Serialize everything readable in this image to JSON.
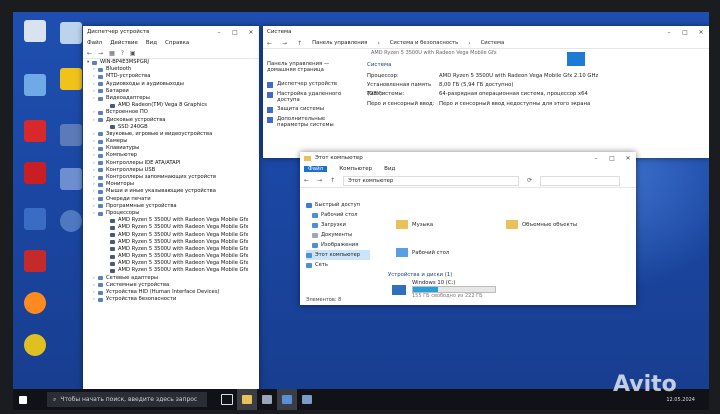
{
  "device_manager": {
    "title": "Диспетчер устройств",
    "menu": [
      "Файл",
      "Действие",
      "Вид",
      "Справка"
    ],
    "root": "WIN-BP4E3MSPGRJ",
    "items": [
      {
        "label": "Bluetooth",
        "level": 1
      },
      {
        "label": "MTD-устройства",
        "level": 1
      },
      {
        "label": "Аудиовходы и аудиовыходы",
        "level": 1
      },
      {
        "label": "Батареи",
        "level": 1
      },
      {
        "label": "Видеоадаптеры",
        "level": 1
      },
      {
        "label": "AMD Radeon(TM) Vega 8 Graphics",
        "level": 2
      },
      {
        "label": "Встроенное ПО",
        "level": 1
      },
      {
        "label": "Дисковые устройства",
        "level": 1
      },
      {
        "label": "SSD 240GB",
        "level": 2
      },
      {
        "label": "Звуковые, игровые и видеоустройства",
        "level": 1
      },
      {
        "label": "Камеры",
        "level": 1
      },
      {
        "label": "Клавиатуры",
        "level": 1
      },
      {
        "label": "Компьютер",
        "level": 1
      },
      {
        "label": "Контроллеры IDE ATA/ATAPI",
        "level": 1
      },
      {
        "label": "Контроллеры USB",
        "level": 1
      },
      {
        "label": "Контроллеры запоминающих устройств",
        "level": 1
      },
      {
        "label": "Мониторы",
        "level": 1
      },
      {
        "label": "Мыши и иные указывающие устройства",
        "level": 1
      },
      {
        "label": "Очереди печати",
        "level": 1
      },
      {
        "label": "Программные устройства",
        "level": 1
      },
      {
        "label": "Процессоры",
        "level": 1
      },
      {
        "label": "AMD Ryzen 5 3500U with Radeon Vega Mobile Gfx",
        "level": 2
      },
      {
        "label": "AMD Ryzen 5 3500U with Radeon Vega Mobile Gfx",
        "level": 2
      },
      {
        "label": "AMD Ryzen 5 3500U with Radeon Vega Mobile Gfx",
        "level": 2
      },
      {
        "label": "AMD Ryzen 5 3500U with Radeon Vega Mobile Gfx",
        "level": 2
      },
      {
        "label": "AMD Ryzen 5 3500U with Radeon Vega Mobile Gfx",
        "level": 2
      },
      {
        "label": "AMD Ryzen 5 3500U with Radeon Vega Mobile Gfx",
        "level": 2
      },
      {
        "label": "AMD Ryzen 5 3500U with Radeon Vega Mobile Gfx",
        "level": 2
      },
      {
        "label": "AMD Ryzen 5 3500U with Radeon Vega Mobile Gfx",
        "level": 2
      },
      {
        "label": "Сетевые адаптеры",
        "level": 1
      },
      {
        "label": "Системные устройства",
        "level": 1
      },
      {
        "label": "Устройства HID (Human Interface Devices)",
        "level": 1
      },
      {
        "label": "Устройства безопасности",
        "level": 1
      }
    ]
  },
  "system": {
    "title": "Система",
    "breadcrumb": [
      "Панель управления",
      "Система и безопасность",
      "Система"
    ],
    "side": [
      {
        "label": "Панель управления — домашняя страница"
      },
      {
        "label": "Диспетчер устройств"
      },
      {
        "label": "Настройка удаленного доступа"
      },
      {
        "label": "Защита системы"
      },
      {
        "label": "Дополнительные параметры системы"
      }
    ],
    "section": "Система",
    "header_fragment": "AMD Ryzen 5 3500U with Radeon Vega Mobile Gfx",
    "rows": [
      {
        "k": "Процессор:",
        "v": "AMD Ryzen 5 3500U with Radeon Vega Mobile Gfx    2.10 GHz"
      },
      {
        "k": "Установленная память (ОЗУ):",
        "v": "8,00 ГБ (5,94 ГБ доступно)"
      },
      {
        "k": "Тип системы:",
        "v": "64-разрядная операционная система, процессор x64"
      },
      {
        "k": "Перо и сенсорный ввод:",
        "v": "Перо и сенсорный ввод недоступны для этого экрана"
      }
    ]
  },
  "explorer": {
    "title": "Этот компьютер",
    "tabs": [
      "Файл",
      "Компьютер",
      "Вид"
    ],
    "address": "Этот компьютер",
    "nav": [
      "Быстрый доступ",
      "Рабочий стол",
      "Загрузки",
      "Документы",
      "Изображения",
      "Этот компьютер",
      "Сеть"
    ],
    "folders": [
      "Музыка",
      "Объемные объекты",
      "Рабочий стол"
    ],
    "drives_header": "Устройства и диски (1)",
    "drive_name": "Windows 10 (C:)",
    "drive_free": "155 ГБ свободно из 222 ГБ",
    "drive_used_fraction": 0.3,
    "status": "Элементов: 8"
  },
  "desktop_icons": [
    "",
    "",
    "",
    "",
    "",
    "",
    "",
    "",
    "",
    "",
    "",
    "",
    ""
  ],
  "taskbar": {
    "search_placeholder": "Чтобы начать поиск, введите здесь запрос",
    "date": "12.05.2024"
  },
  "watermark": "Avito"
}
